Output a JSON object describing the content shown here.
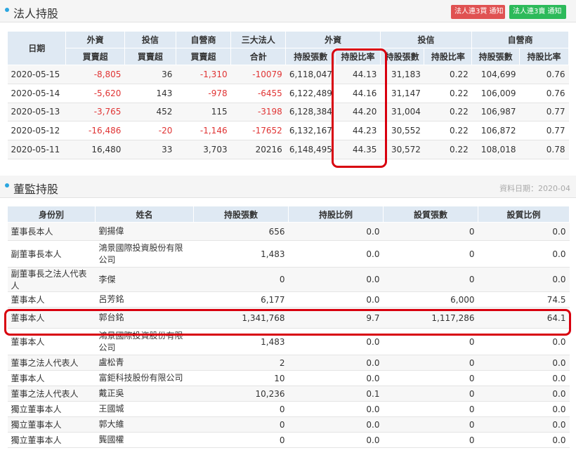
{
  "institutional": {
    "title": "法人持股",
    "buttons": {
      "red": "法人連3買 通知",
      "green": "法人連3賣 通知"
    },
    "head_top": {
      "date": "日期",
      "foreign": "外資",
      "trust": "投信",
      "dealer": "自營商",
      "three": "三大法人"
    },
    "head_sub": {
      "foreign_net": "買賣超",
      "trust_net": "買賣超",
      "dealer_net": "買賣超",
      "three_total": "合計",
      "f_shares": "持股張數",
      "f_ratio": "持股比率",
      "t_shares": "持股張數",
      "t_ratio": "持股比率",
      "d_shares": "持股張數",
      "d_ratio": "持股比率"
    },
    "rows": [
      [
        "2020-05-15",
        "-8,805",
        "36",
        "-1,310",
        "-10079",
        "6,118,047",
        "44.13",
        "31,183",
        "0.22",
        "104,699",
        "0.76"
      ],
      [
        "2020-05-14",
        "-5,620",
        "143",
        "-978",
        "-6455",
        "6,122,489",
        "44.16",
        "31,147",
        "0.22",
        "106,009",
        "0.76"
      ],
      [
        "2020-05-13",
        "-3,765",
        "452",
        "115",
        "-3198",
        "6,128,384",
        "44.20",
        "31,004",
        "0.22",
        "106,987",
        "0.77"
      ],
      [
        "2020-05-12",
        "-16,486",
        "-20",
        "-1,146",
        "-17652",
        "6,132,167",
        "44.23",
        "30,552",
        "0.22",
        "106,872",
        "0.77"
      ],
      [
        "2020-05-11",
        "16,480",
        "33",
        "3,703",
        "20216",
        "6,148,495",
        "44.35",
        "30,572",
        "0.22",
        "108,018",
        "0.78"
      ]
    ]
  },
  "directors": {
    "title": "董監持股",
    "date_info": "資料日期：2020-04",
    "headers": [
      "身份別",
      "姓名",
      "持股張數",
      "持股比例",
      "設質張數",
      "設質比例"
    ],
    "rows": [
      [
        "董事長本人",
        "劉揚偉",
        "656",
        "0.0",
        "0",
        "0.0"
      ],
      [
        "副董事長本人",
        "鴻景國際投資股份有限公司",
        "1,483",
        "0.0",
        "0",
        "0.0"
      ],
      [
        "副董事長之法人代表人",
        "李傑",
        "0",
        "0.0",
        "0",
        "0.0"
      ],
      [
        "董事本人",
        "呂芳銘",
        "6,177",
        "0.0",
        "6,000",
        "74.5"
      ],
      [
        "董事本人",
        "郭台銘",
        "1,341,768",
        "9.7",
        "1,117,286",
        "64.1"
      ],
      [
        "董事本人",
        "鴻景國際投資股份有限公司",
        "1,483",
        "0.0",
        "0",
        "0.0"
      ],
      [
        "董事之法人代表人",
        "盧松青",
        "2",
        "0.0",
        "0",
        "0.0"
      ],
      [
        "董事本人",
        "富鉅科技股份有限公司",
        "10",
        "0.0",
        "0",
        "0.0"
      ],
      [
        "董事之法人代表人",
        "戴正吳",
        "10,236",
        "0.1",
        "0",
        "0.0"
      ],
      [
        "獨立董事本人",
        "王國城",
        "0",
        "0.0",
        "0",
        "0.0"
      ],
      [
        "獨立董事本人",
        "郭大維",
        "0",
        "0.0",
        "0",
        "0.0"
      ],
      [
        "獨立董事本人",
        "龔國權",
        "0",
        "0.0",
        "0",
        "0.0"
      ]
    ]
  },
  "colors": {
    "negative": "#e03434",
    "highlight": "#d8000e",
    "header_bg": "#dfe9f3",
    "accent": "#2aa6e0"
  }
}
